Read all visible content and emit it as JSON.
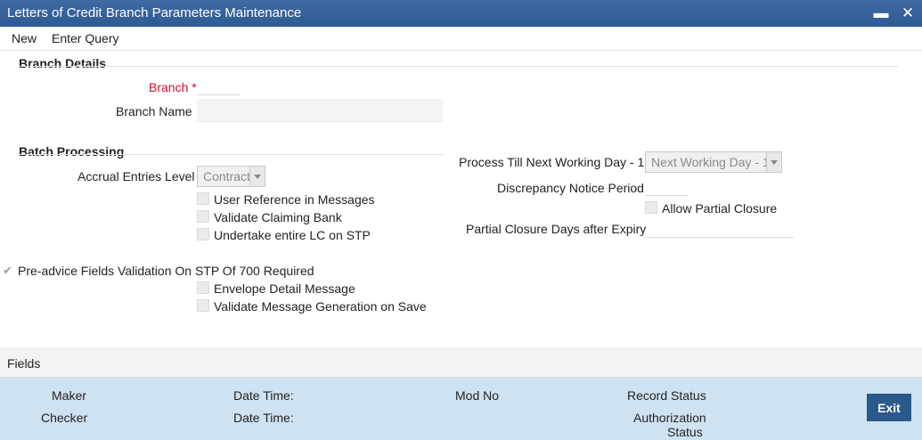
{
  "window": {
    "title": "Letters of Credit Branch Parameters Maintenance",
    "minimize_glyph": "▬",
    "close_glyph": "✕"
  },
  "menu": {
    "new": "New",
    "enter_query": "Enter Query"
  },
  "branch_details": {
    "heading": "Branch Details",
    "branch_label": "Branch",
    "required_marker": "*",
    "branch_value": "",
    "branch_name_label": "Branch Name",
    "branch_name_value": ""
  },
  "batch": {
    "heading": "Batch Processing",
    "accrual_label": "Accrual Entries Level",
    "accrual_value": "Contract",
    "user_ref": "User Reference in Messages",
    "validate_claiming": "Validate Claiming Bank",
    "undertake": "Undertake entire LC on STP",
    "pre_advice": "Pre-advice Fields Validation On STP Of 700 Required",
    "envelope": "Envelope Detail Message",
    "validate_msg_gen": "Validate Message Generation on Save",
    "process_till_label": "Process Till Next Working Day - 1",
    "process_till_value": "Next Working Day - 1",
    "discrepancy_label": "Discrepancy Notice Period",
    "discrepancy_value": "",
    "allow_partial": "Allow Partial Closure",
    "partial_days_label": "Partial Closure Days after Expiry",
    "partial_days_value": ""
  },
  "footer": {
    "fields": "Fields",
    "maker": "Maker",
    "checker": "Checker",
    "date_time_1": "Date Time:",
    "date_time_2": "Date Time:",
    "mod_no": "Mod No",
    "record_status": "Record Status",
    "authorization": "Authorization",
    "status": "Status",
    "exit": "Exit"
  },
  "colors": {
    "title_bar": "#2f5a93",
    "footer_bg": "#cfe2f2",
    "exit_button": "#2a5a8c",
    "required": "#c8102e"
  },
  "icons": {
    "minimize": "minimize-icon",
    "close": "close-icon",
    "dropdown": "chevron-down-icon",
    "check": "checkmark-icon"
  }
}
